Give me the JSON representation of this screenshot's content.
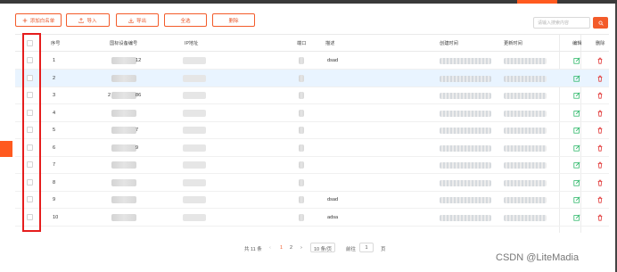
{
  "toolbar": {
    "add_label": "添加白名单",
    "import_label": "导入",
    "export_label": "导出",
    "all_label": "全选",
    "delete_label": "删除"
  },
  "search": {
    "placeholder": "请输入搜索内容"
  },
  "table": {
    "headers": [
      "序号",
      "国标设备编号",
      "IP地址",
      "端口",
      "描述",
      "创建时间",
      "更新时间",
      "编辑",
      "删除"
    ],
    "rows": [
      {
        "index": "1",
        "code_tail": "12",
        "desc": "dsad"
      },
      {
        "index": "2",
        "code_tail": "",
        "desc": ""
      },
      {
        "index": "3",
        "code_head": "2",
        "code_tail": "86",
        "desc": ""
      },
      {
        "index": "4",
        "code_tail": "",
        "desc": ""
      },
      {
        "index": "5",
        "code_tail": "7",
        "desc": ""
      },
      {
        "index": "6",
        "code_tail": "9",
        "desc": ""
      },
      {
        "index": "7",
        "code_tail": "",
        "desc": ""
      },
      {
        "index": "8",
        "code_tail": "",
        "desc": ""
      },
      {
        "index": "9",
        "code_tail": "",
        "desc": "dsad"
      },
      {
        "index": "10",
        "code_tail": "",
        "desc": "adsa"
      }
    ]
  },
  "pager": {
    "total": "共 11 条",
    "prev": "‹",
    "page1": "1",
    "page2": "2",
    "next": "›",
    "size": "10 条/页",
    "goto": "前往",
    "goto_value": "1",
    "page_unit": "页"
  },
  "watermark": "CSDN @LiteMadia",
  "colors": {
    "accent": "#f35b2a",
    "highlight_box": "#e51d1d",
    "row_hover": "#e9f4ff"
  },
  "icons": {
    "add": "plus-icon",
    "import": "upload-icon",
    "export": "download-icon",
    "search": "search-icon",
    "edit": "edit-icon",
    "delete": "trash-icon"
  }
}
